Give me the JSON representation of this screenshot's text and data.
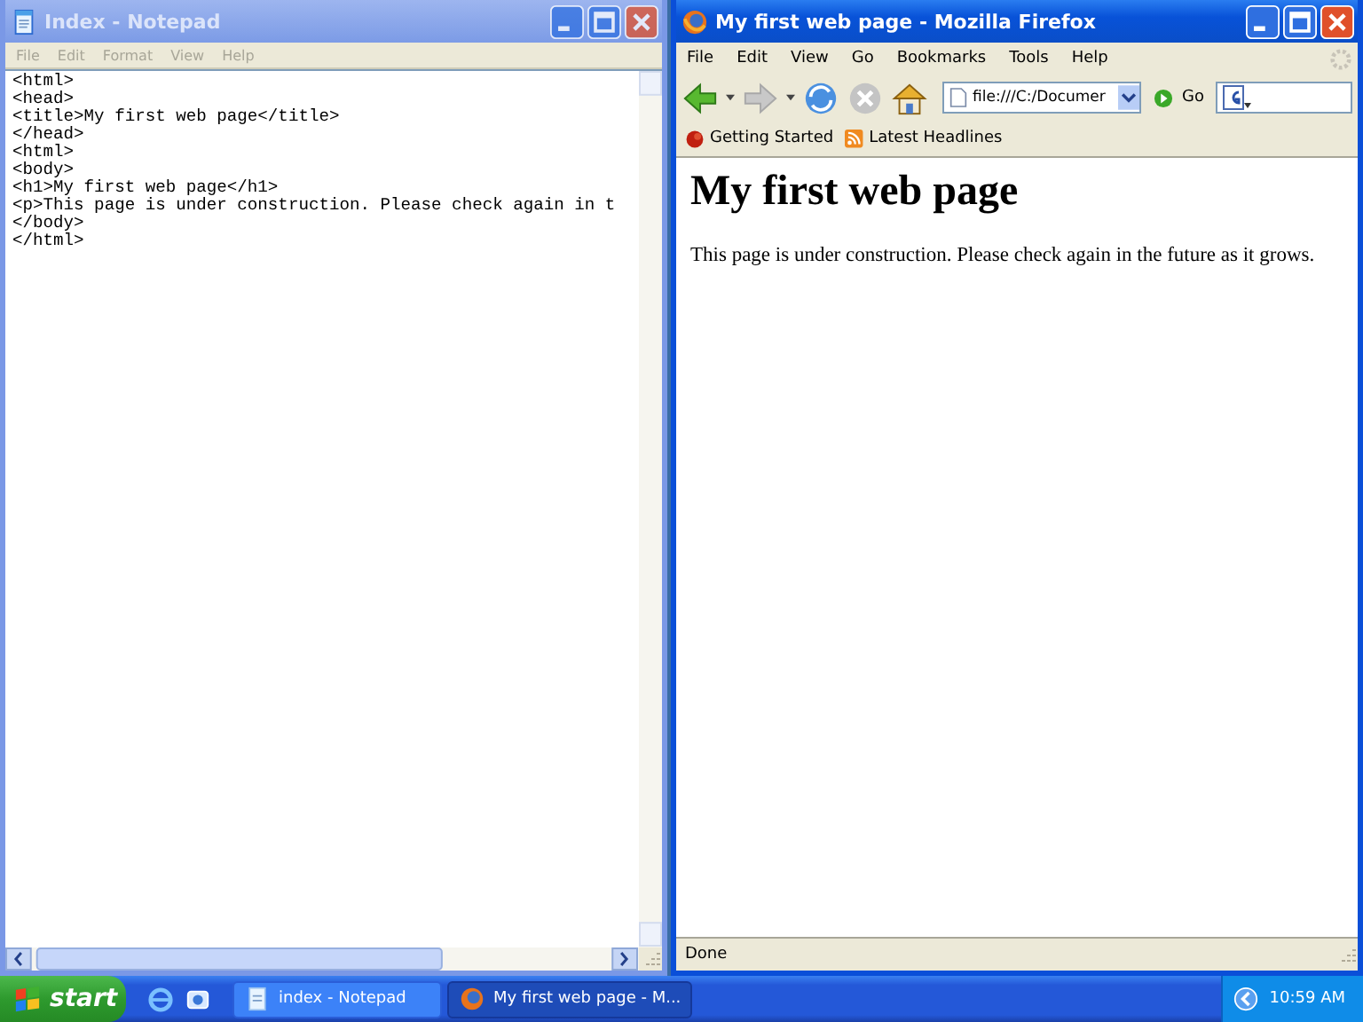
{
  "notepad": {
    "title": "Index - Notepad",
    "active": false,
    "menu": [
      {
        "label": "File",
        "disabled": true
      },
      {
        "label": "Edit",
        "disabled": true
      },
      {
        "label": "Format",
        "disabled": true
      },
      {
        "label": "View",
        "disabled": true
      },
      {
        "label": "Help",
        "disabled": true
      }
    ],
    "lines": [
      "<html>",
      "<head>",
      "<title>My first web page</title>",
      "</head>",
      "<html>",
      "<body>",
      "<h1>My first web page</h1>",
      "<p>This page is under construction. Please check again in t",
      "</body>",
      "</html>"
    ]
  },
  "firefox": {
    "title": "My first web page - Mozilla Firefox",
    "active": true,
    "menu": [
      {
        "label": "File",
        "disabled": false
      },
      {
        "label": "Edit",
        "disabled": false
      },
      {
        "label": "View",
        "disabled": false
      },
      {
        "label": "Go",
        "disabled": false
      },
      {
        "label": "Bookmarks",
        "disabled": false
      },
      {
        "label": "Tools",
        "disabled": false
      },
      {
        "label": "Help",
        "disabled": false
      }
    ],
    "address": "file:///C:/Documer",
    "go": "Go",
    "bookmarks": [
      "Getting Started",
      "Latest Headlines"
    ],
    "page": {
      "heading": "My first web page",
      "paragraph": "This page is under construction. Please check again in the future as it grows."
    },
    "status": "Done"
  },
  "taskbar": {
    "start": "start",
    "tasks": [
      {
        "label": "index - Notepad",
        "kind": "notepad",
        "selected": false
      },
      {
        "label": "My first web page - M...",
        "kind": "firefox",
        "selected": true
      }
    ],
    "clock": "10:59 AM"
  }
}
